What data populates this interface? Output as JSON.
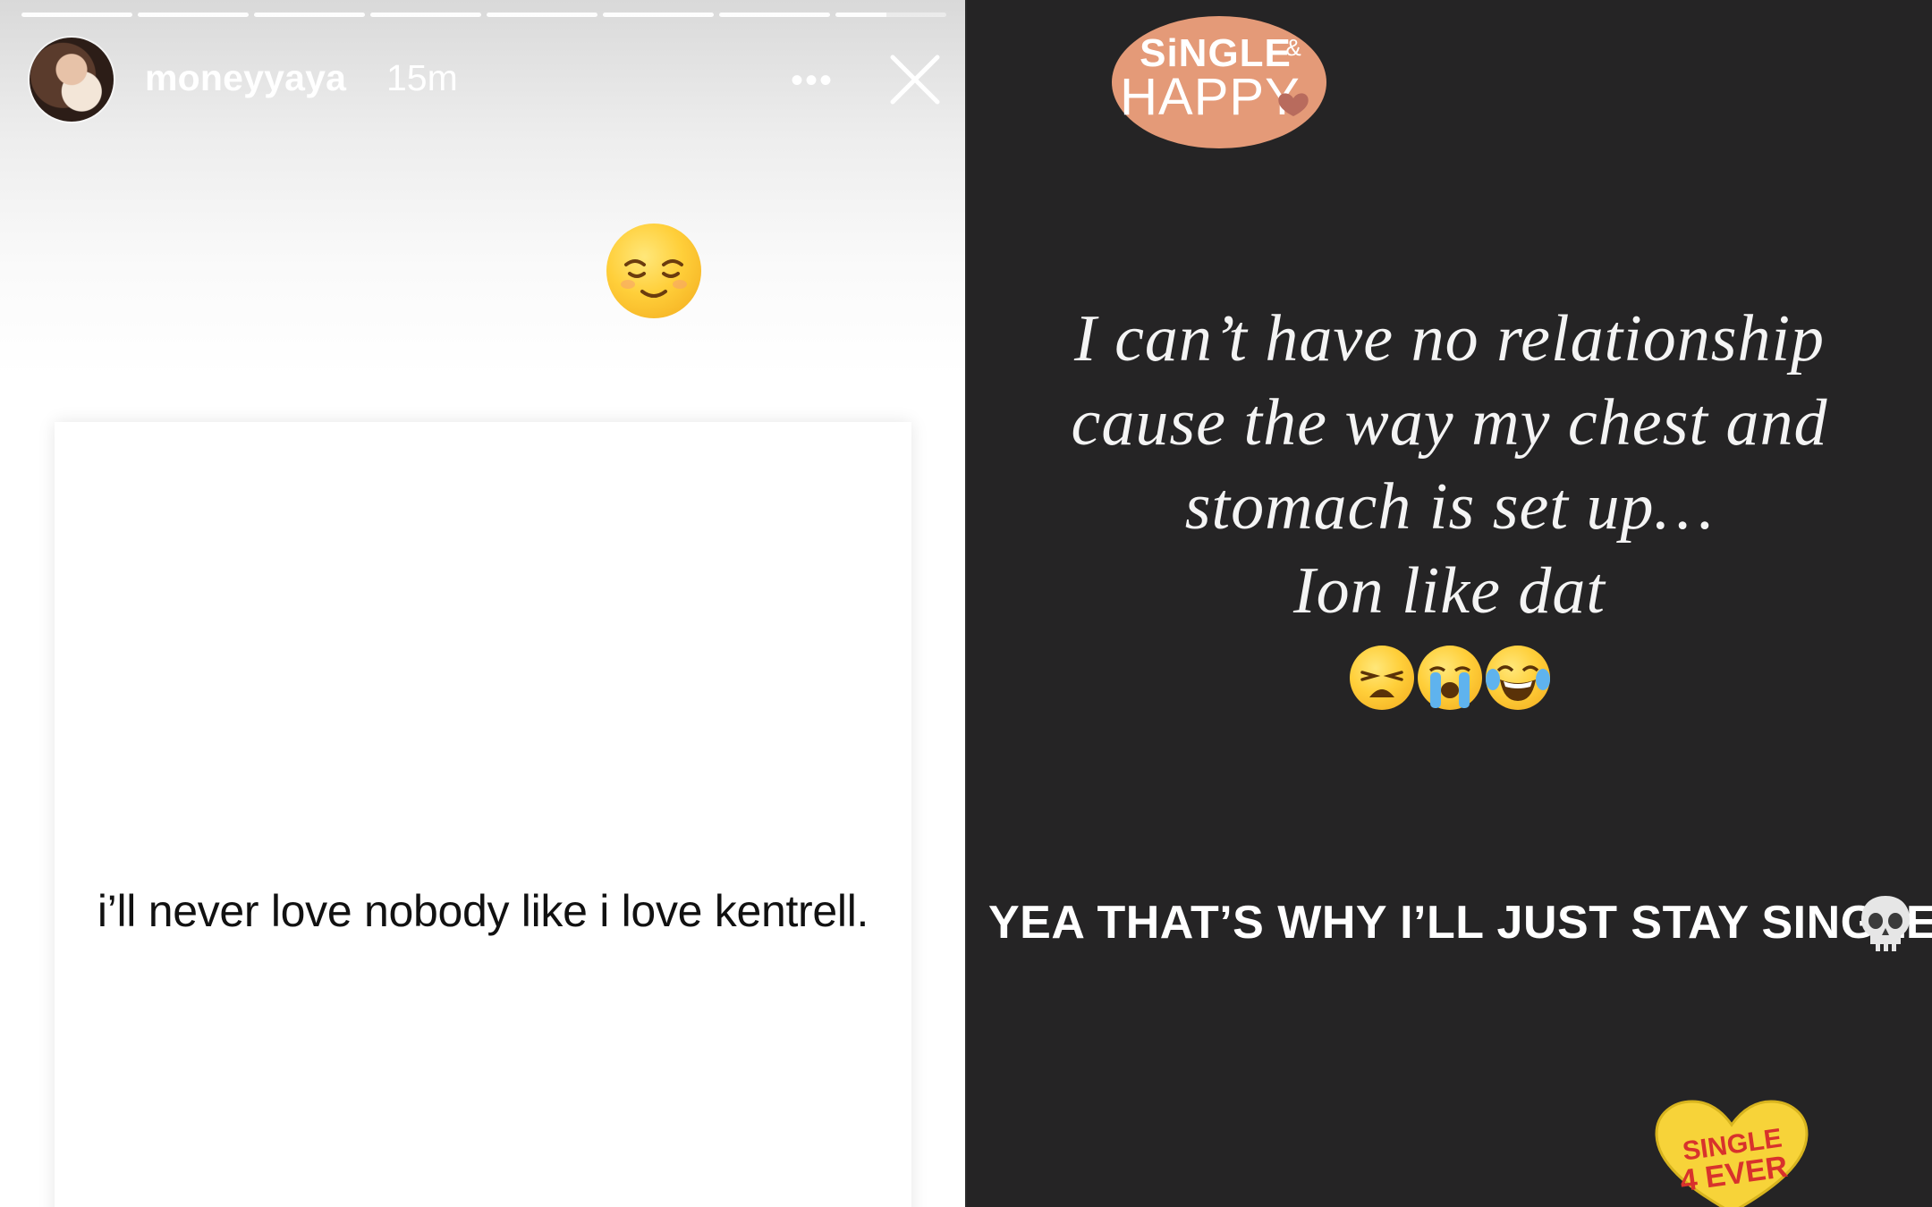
{
  "left_story": {
    "username": "moneyyaya",
    "time_ago": "15m",
    "more_label": "•••",
    "progress_segments": 8,
    "current_segment_progress": 0.46,
    "card_text": "i’ll never love nobody like i love kentrell.",
    "emoji": "relieved-face"
  },
  "right_story": {
    "sticker_top": {
      "line1": "SiNGLE",
      "amp": "&",
      "line2": "HAPPY"
    },
    "quote_lines": [
      "I can’t have no relationship",
      "cause the way my chest and",
      "stomach is set up…",
      "Ion like dat"
    ],
    "emoji_row": [
      "weary-face",
      "loudly-crying-face",
      "face-with-tears-of-joy"
    ],
    "caps_text": "YEA THAT’S WHY I’LL JUST STAY SINGLE",
    "sticker_bottom": {
      "line1": "SINGLE",
      "line2": "4 EVER"
    }
  },
  "colors": {
    "right_background": "#252425",
    "sticker_happy": "#e49a78",
    "heart_sticker": "#f7d339",
    "heart_text": "#d8322c"
  }
}
